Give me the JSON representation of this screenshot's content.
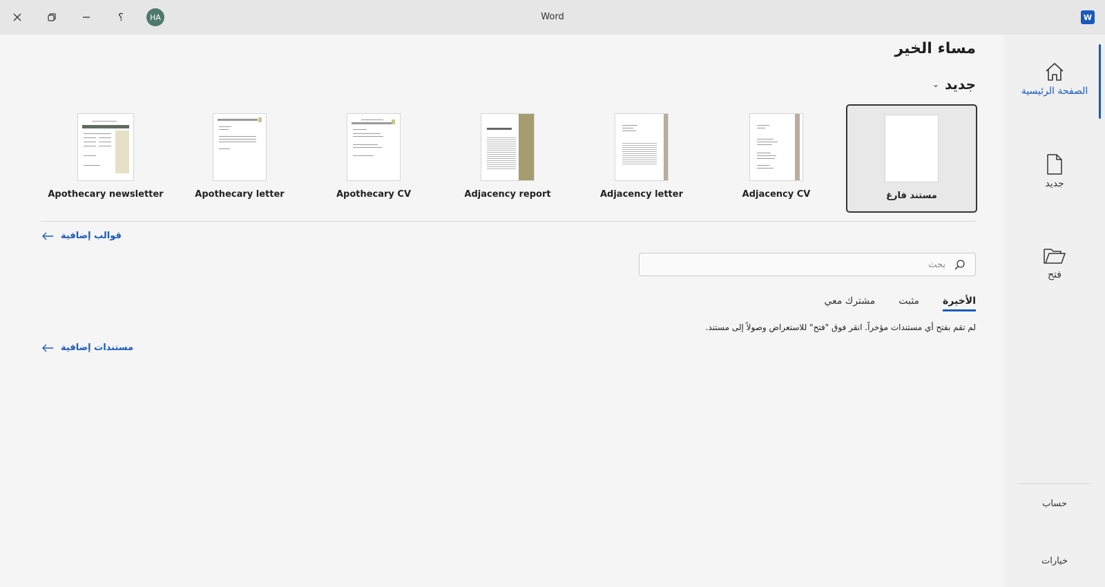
{
  "window": {
    "title": "Word",
    "user_initials": "HA",
    "help_label": "؟",
    "app_logo_letter": "W"
  },
  "nav": {
    "home": "الصفحة الرئيسية",
    "new": "جديد",
    "open": "فتح",
    "account": "حساب",
    "options": "خيارات"
  },
  "main": {
    "greeting": "مساء الخير",
    "new_section": "جديد",
    "templates": [
      {
        "name": "مستند فارغ"
      },
      {
        "name": "Adjacency CV"
      },
      {
        "name": "Adjacency letter"
      },
      {
        "name": "Adjacency report"
      },
      {
        "name": "Apothecary CV"
      },
      {
        "name": "Apothecary letter"
      },
      {
        "name": "Apothecary newsletter"
      }
    ],
    "more_templates": "قوالب إضافية",
    "search_placeholder": "بحث",
    "tabs": [
      "الأخيرة",
      "مثبت",
      "مشترك معي"
    ],
    "empty_message": "لم تقم بفتح أي مستندات مؤخراً. انقر فوق \"فتح\" للاستعراض وصولاً إلى مستند.",
    "more_documents": "مستندات إضافية"
  },
  "colors": {
    "accent": "#185abd",
    "avatar": "#4e7a6d",
    "template_accent": "#a59d6f"
  }
}
